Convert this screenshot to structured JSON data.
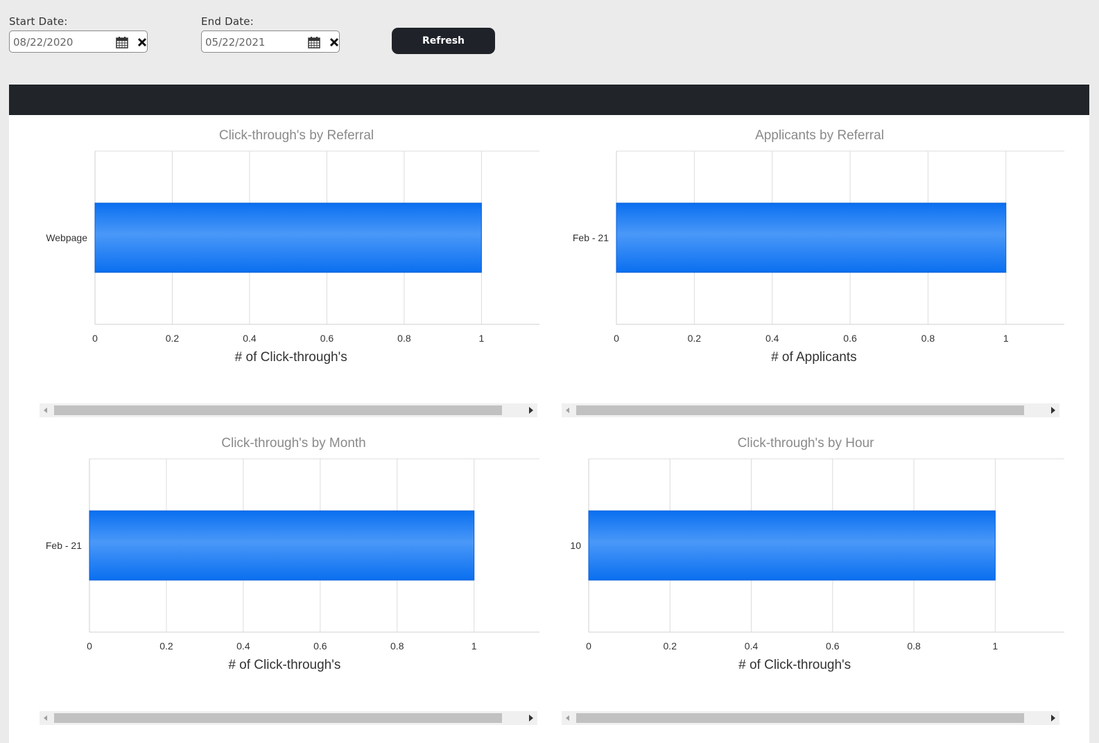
{
  "filters": {
    "start_label": "Start Date:",
    "start_value": "08/22/2020",
    "end_label": "End Date:",
    "end_value": "05/22/2021",
    "refresh_label": "Refresh"
  },
  "colors": {
    "bar": "#1a7cf0",
    "header_bar": "#212428",
    "button": "#1f2329"
  },
  "chart_data": [
    {
      "type": "bar",
      "orientation": "horizontal",
      "title": "Click-through's by Referral",
      "categories": [
        "Webpage"
      ],
      "values": [
        1
      ],
      "xlabel": "# of Click-through's",
      "ylabel": "",
      "xlim": [
        0,
        1.15
      ],
      "ticks": [
        "0",
        "0.2",
        "0.4",
        "0.6",
        "0.8",
        "1"
      ],
      "grid": true
    },
    {
      "type": "bar",
      "orientation": "horizontal",
      "title": "Applicants by Referral",
      "categories": [
        "Feb - 21"
      ],
      "values": [
        1
      ],
      "xlabel": "# of Applicants",
      "ylabel": "",
      "xlim": [
        0,
        1.15
      ],
      "ticks": [
        "0",
        "0.2",
        "0.4",
        "0.6",
        "0.8",
        "1"
      ],
      "grid": true
    },
    {
      "type": "bar",
      "orientation": "horizontal",
      "title": "Click-through's by Month",
      "categories": [
        "Feb - 21"
      ],
      "values": [
        1
      ],
      "xlabel": "# of Click-through's",
      "ylabel": "",
      "xlim": [
        0,
        1.17
      ],
      "ticks": [
        "0",
        "0.2",
        "0.4",
        "0.6",
        "0.8",
        "1"
      ],
      "grid": true
    },
    {
      "type": "bar",
      "orientation": "horizontal",
      "title": "Click-through's by Hour",
      "categories": [
        "10"
      ],
      "values": [
        1
      ],
      "xlabel": "# of Click-through's",
      "ylabel": "",
      "xlim": [
        0,
        1.17
      ],
      "ticks": [
        "0",
        "0.2",
        "0.4",
        "0.6",
        "0.8",
        "1"
      ],
      "grid": true
    }
  ]
}
